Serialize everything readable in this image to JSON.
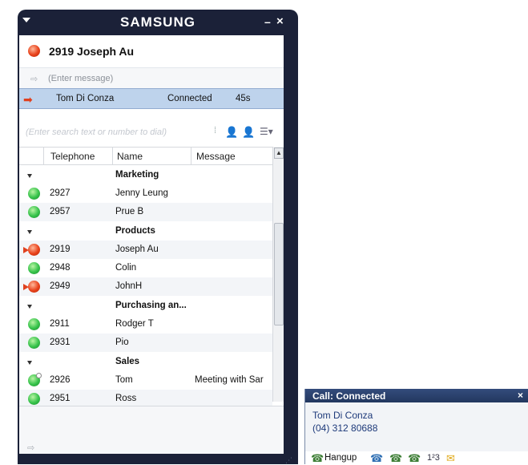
{
  "window": {
    "brand": "SAMSUNG",
    "minimize": "–",
    "close": "×"
  },
  "contact": {
    "name": "2919 Joseph Au",
    "status_color": "#e8411a",
    "message_placeholder": "(Enter message)"
  },
  "call": {
    "name": "Tom Di Conza",
    "status": "Connected",
    "duration": "45s"
  },
  "search": {
    "placeholder": "(Enter search text or number to dial)"
  },
  "columns": [
    "Telephone",
    "Name",
    "Message"
  ],
  "groups": [
    {
      "name": "Marketing",
      "items": [
        {
          "tel": "2927",
          "name": "Jenny Leung",
          "status": "available",
          "message": ""
        },
        {
          "tel": "2957",
          "name": "Prue B",
          "status": "available",
          "message": ""
        }
      ]
    },
    {
      "name": "Products",
      "items": [
        {
          "tel": "2919",
          "name": "Joseph Au",
          "status": "busy",
          "message": ""
        },
        {
          "tel": "2948",
          "name": "Colin",
          "status": "available",
          "message": ""
        },
        {
          "tel": "2949",
          "name": "JohnH",
          "status": "busy",
          "message": ""
        }
      ]
    },
    {
      "name": "Purchasing an...",
      "items": [
        {
          "tel": "2911",
          "name": "Rodger T",
          "status": "available",
          "message": ""
        },
        {
          "tel": "2931",
          "name": "Pio",
          "status": "available",
          "message": ""
        }
      ]
    },
    {
      "name": "Sales",
      "items": [
        {
          "tel": "2926",
          "name": "Tom",
          "status": "available-note",
          "message": "Meeting with Sar"
        },
        {
          "tel": "2951",
          "name": "Ross",
          "status": "available",
          "message": ""
        }
      ]
    }
  ],
  "popup": {
    "title": "Call: Connected",
    "close": "×",
    "name": "Tom Di Conza",
    "number": "(04) 312 80688",
    "hangup_label": "Hangup",
    "keypad_label": "1²3"
  },
  "colors": {
    "window_frame": "#1b2138",
    "call_bar": "#bed3ec",
    "busy": "#e8411a",
    "available": "#35c24a",
    "popup_title": "#2b4270"
  }
}
